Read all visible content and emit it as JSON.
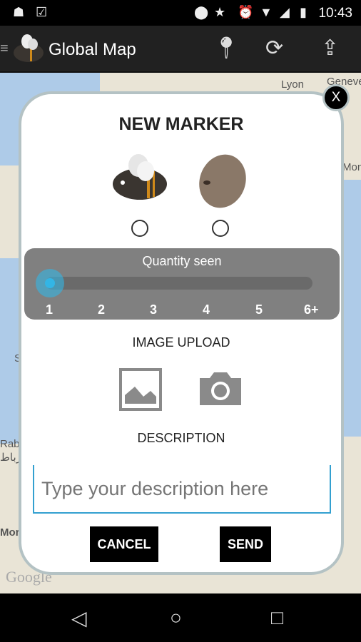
{
  "status_bar": {
    "time": "10:43",
    "icons": [
      "android-debug-icon",
      "clipboard-check-icon",
      "location-icon",
      "star-icon",
      "alarm-icon",
      "wifi-icon",
      "signal-icon",
      "battery-charging-icon"
    ]
  },
  "app_bar": {
    "title": "Global Map",
    "actions": [
      "location-pin-icon",
      "refresh-icon",
      "upload-icon"
    ]
  },
  "map": {
    "labels": [
      "Lyon",
      "Geneve",
      "Mona",
      "Rabat",
      "الرباط",
      "Mor",
      "S",
      "Google"
    ]
  },
  "dialog": {
    "title": "NEW MARKER",
    "close_label": "X",
    "marker_types": [
      "bee",
      "seed"
    ],
    "quantity": {
      "label": "Quantity seen",
      "ticks": [
        "1",
        "2",
        "3",
        "4",
        "5",
        "6+"
      ],
      "selected": "1"
    },
    "image_upload_label": "IMAGE UPLOAD",
    "image_upload_options": [
      "gallery-icon",
      "camera-icon"
    ],
    "description_label": "DESCRIPTION",
    "description_placeholder": "Type your description here",
    "cancel": "CANCEL",
    "send": "SEND"
  },
  "colors": {
    "accent": "#33b5e5",
    "appbar": "#212121"
  }
}
